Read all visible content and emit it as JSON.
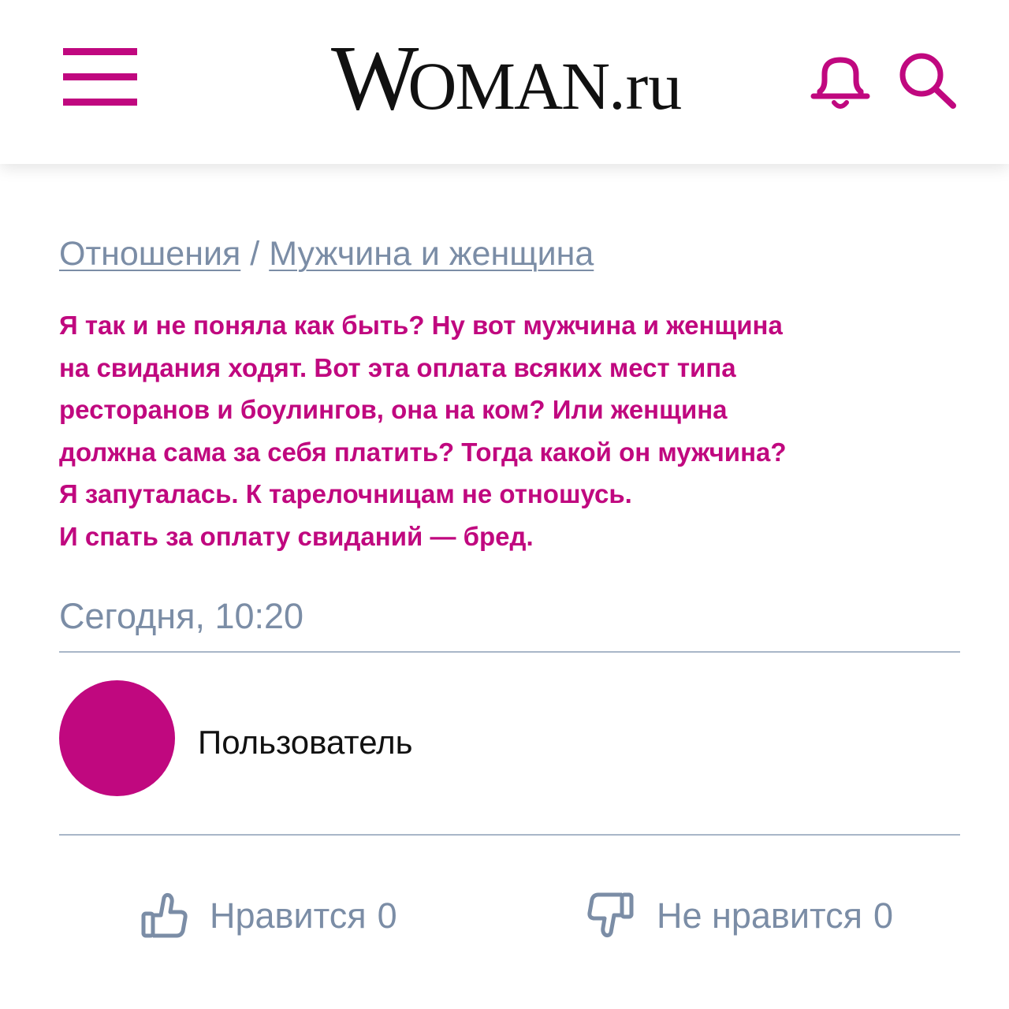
{
  "header": {
    "logo_w": "W",
    "logo_rest": "OMAN",
    "logo_suffix": ".ru",
    "menu_icon": "hamburger-menu-icon",
    "notification_icon": "bell-icon",
    "search_icon": "search-icon"
  },
  "breadcrumb": {
    "items": [
      {
        "label": "Отношения"
      },
      {
        "label": "Мужчина и женщина"
      }
    ],
    "separator": "/"
  },
  "post": {
    "text": "Я так и не поняла как быть? Ну вот мужчина и женщина\nна свидания ходят. Вот эта оплата всяких мест типа\nресторанов и боулингов, она на ком? Или женщина\nдолжна сама за себя платить? Тогда какой он мужчина?\nЯ запуталась. К тарелочницам не отношусь.\nИ спать за оплату свиданий — бред.",
    "date": "Сегодня, 10:20"
  },
  "author": {
    "name": "Пользователь"
  },
  "reactions": {
    "like_label": "Нравится",
    "like_count": "0",
    "dislike_label": "Не нравится",
    "dislike_count": "0"
  },
  "colors": {
    "accent": "#c0087f",
    "muted": "#7b8da6",
    "divider": "#a9b6c8",
    "text": "#111111"
  }
}
